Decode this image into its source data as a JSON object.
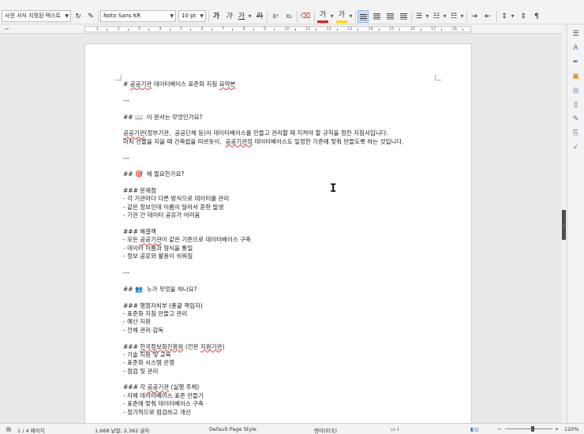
{
  "toolbar": {
    "paragraph_style": "사전 서식 지정된 텍스트",
    "font_name": "Noto Sans KR",
    "font_size": "10 pt",
    "bold": "가",
    "italic": "가",
    "underline": "가",
    "strikethrough": "카",
    "superscript": "X²",
    "subscript": "X₂",
    "font_color": "가",
    "highlight_color": "가"
  },
  "colors": {
    "font_color": "#d42020",
    "highlight": "#ffd700",
    "accent": "#3a6fb5"
  },
  "ruler": {
    "numbers": [
      "1",
      "2",
      "3",
      "4",
      "5",
      "6",
      "7",
      "8",
      "9",
      "10",
      "11",
      "12",
      "13",
      "14",
      "15",
      "16",
      "17",
      "18"
    ]
  },
  "document": {
    "lines": [
      [
        "# ",
        "~공공기관",
        " 데이터베이스 표준화 지침 ",
        "~요약본"
      ],
      [],
      [
        "---"
      ],
      [],
      [
        "## ",
        "!📖",
        "  이 문서는 무엇인가요?"
      ],
      [],
      [
        "~공공기관",
        "(정부기관,  공공단체 등)이 데이터베이스를 만들고 관리할 때 지켜야 할 규칙을 정한 지침서입니다."
      ],
      [
        "마치 건물을 지을 때 건축법을 따르듯이,  ",
        "~공공기관의",
        " 데이터베이스도 일정한 기준에 맞춰 만들도록 하는 것입니다."
      ],
      [],
      [
        "---"
      ],
      [],
      [
        "## ",
        "!🎯",
        "  왜 필요한가요?"
      ],
      [],
      [
        "### 문제점"
      ],
      [
        "- 각 기관마다 다른 방식으로 데이터를 관리"
      ],
      [
        "- 같은 정보인데 이름이 달라서 혼란 발생"
      ],
      [
        "- 기관 간 데이터 공유가 어려움"
      ],
      [],
      [
        "### 해결책"
      ],
      [
        "- 모든 ",
        "~공공기관",
        "이 같은 기준으로 데이터베이스 구축"
      ],
      [
        "- 데이터 이름과 형식을 통일"
      ],
      [
        "- 정보 공유와 활용이 쉬워짐"
      ],
      [],
      [
        "---"
      ],
      [],
      [
        "## ",
        "!👥",
        "  누가 무엇을 하나요?"
      ],
      [],
      [
        "### 행정자치부 (총괄 책임자)"
      ],
      [
        "- 표준화 지침 만들고 관리"
      ],
      [
        "- 예산 지원"
      ],
      [
        "- 전체 관리·감독"
      ],
      [],
      [
        "### ",
        "~한국정보화진흥원",
        " (전문 ",
        "~지원기관",
        ")"
      ],
      [
        "- 기술 지원 및 교육"
      ],
      [
        "- 표준화 시스템 운영"
      ],
      [
        "- 점검 및 관리"
      ],
      [],
      [
        "### 각 ",
        "~공공기관",
        " (실행 주체)"
      ],
      [
        "- 자체 데이터베이스 표준 만들기"
      ],
      [
        "- 표준에 맞춰 데이터베이스 구축"
      ],
      [
        "- 정기적으로 점검하고 개선"
      ],
      [],
      [
        "---"
      ]
    ]
  },
  "statusbar": {
    "page_info": "1 / 4 페이지",
    "word_count": "1,668 낱말, 2,362 글자",
    "page_style": "Default Page Style",
    "language": "영어(미국)",
    "zoom": "120%"
  }
}
